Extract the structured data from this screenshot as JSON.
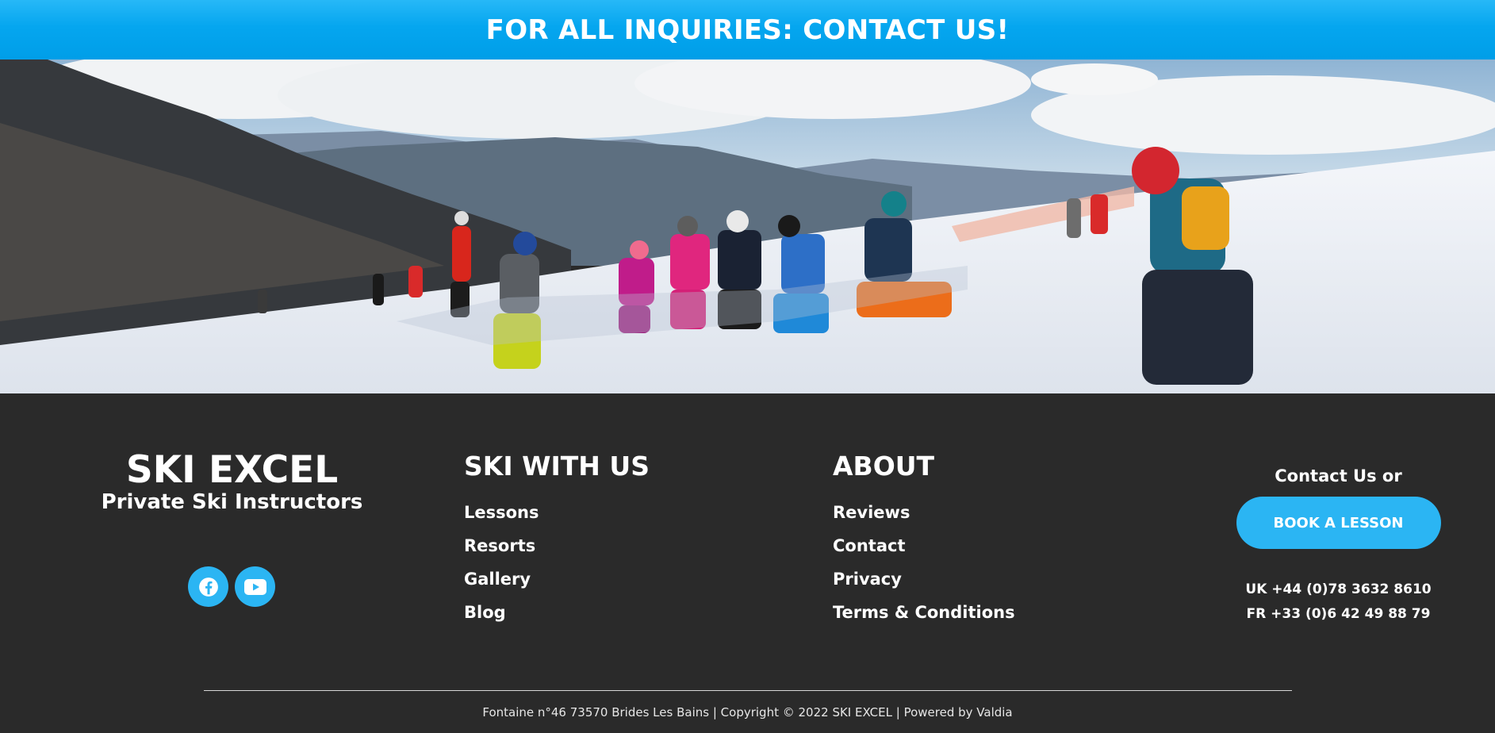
{
  "banner": {
    "text": "FOR ALL INQUIRIES: CONTACT US!"
  },
  "colors": {
    "accent": "#2bb5f3",
    "banner": "#05a6ef",
    "footer_bg": "#2a2a2a"
  },
  "brand": {
    "name": "SKI EXCEL",
    "tagline": "Private Ski Instructors"
  },
  "socials": [
    {
      "icon": "facebook-icon"
    },
    {
      "icon": "youtube-icon"
    }
  ],
  "ski_with_us": {
    "title": "SKI WITH US",
    "links": [
      "Lessons",
      "Resorts",
      "Gallery",
      "Blog"
    ]
  },
  "about": {
    "title": "ABOUT",
    "links": [
      "Reviews",
      "Contact",
      "Privacy",
      "Terms & Conditions"
    ]
  },
  "contact": {
    "lead": "Contact Us or",
    "button_label": "BOOK A LESSON",
    "phone_uk": "UK +44 (0)78 3632 8610",
    "phone_fr": "FR +33 (0)6 42 49 88 79"
  },
  "legal": {
    "address": "Fontaine n°46 73570 Brides Les Bains",
    "copyright": "Copyright © 2022 SKI EXCEL",
    "powered": "Powered by Valdia"
  }
}
